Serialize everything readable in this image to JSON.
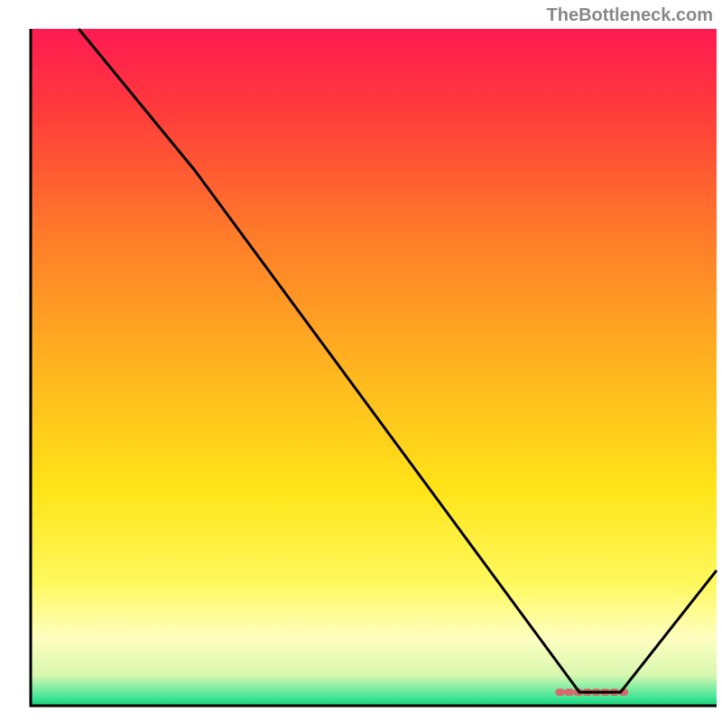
{
  "watermark": "TheBottleneck.com",
  "chart_data": {
    "type": "line",
    "title": "",
    "xlabel": "",
    "ylabel": "",
    "xlim": [
      0,
      100
    ],
    "ylim": [
      0,
      100
    ],
    "line": {
      "points": [
        {
          "x": 7,
          "y": 100
        },
        {
          "x": 24,
          "y": 79
        },
        {
          "x": 80,
          "y": 2
        },
        {
          "x": 86,
          "y": 2
        },
        {
          "x": 100,
          "y": 20
        }
      ]
    },
    "flat_marker": {
      "x_start": 77,
      "x_end": 87,
      "y": 2,
      "color": "#d46a6a"
    },
    "background": {
      "type": "vertical-gradient",
      "stops": [
        {
          "offset": 0.0,
          "color": "#ff1a52"
        },
        {
          "offset": 0.12,
          "color": "#ff3b3b"
        },
        {
          "offset": 0.3,
          "color": "#ff7a2a"
        },
        {
          "offset": 0.5,
          "color": "#ffb41f"
        },
        {
          "offset": 0.68,
          "color": "#ffe418"
        },
        {
          "offset": 0.82,
          "color": "#fff95e"
        },
        {
          "offset": 0.9,
          "color": "#ffffc0"
        },
        {
          "offset": 0.955,
          "color": "#d8f7b0"
        },
        {
          "offset": 0.985,
          "color": "#4fe89a"
        },
        {
          "offset": 1.0,
          "color": "#11d277"
        }
      ]
    },
    "axes": {
      "color": "#000000",
      "width": 3
    }
  }
}
